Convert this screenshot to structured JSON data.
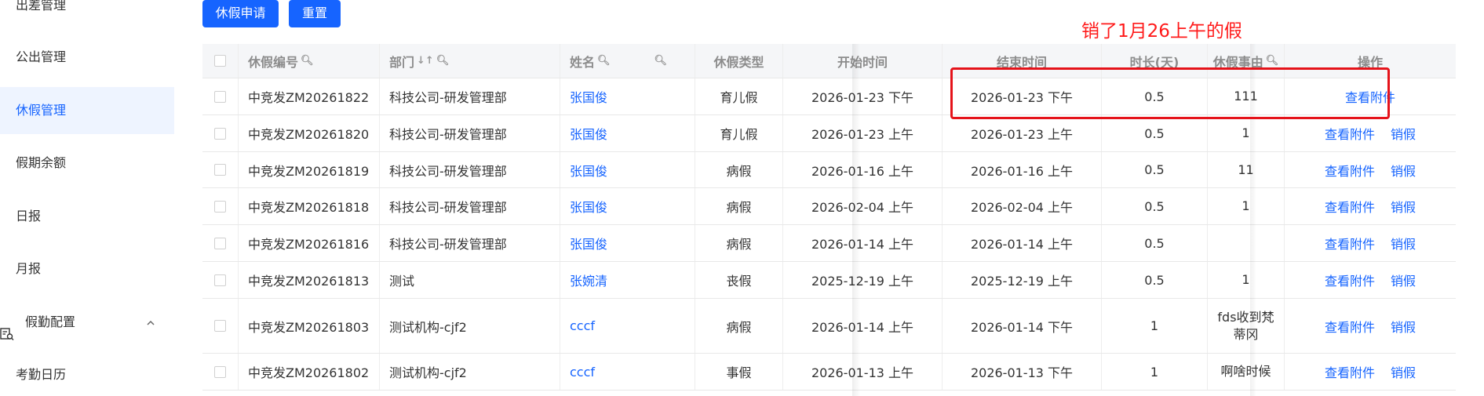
{
  "sidebar": {
    "items": [
      {
        "label": "出差管理",
        "active": false
      },
      {
        "label": "公出管理",
        "active": false
      },
      {
        "label": "休假管理",
        "active": true
      },
      {
        "label": "假期余额",
        "active": false
      },
      {
        "label": "日报",
        "active": false
      },
      {
        "label": "月报",
        "active": false
      }
    ],
    "group": {
      "label": "假勤配置",
      "icon": "list-search-icon",
      "chevron": "chevron-up-icon"
    },
    "sub_items": [
      {
        "label": "考勤日历"
      }
    ]
  },
  "toolbar": {
    "leave_apply_label": "休假申请",
    "reset_label": "重置"
  },
  "annotation": {
    "text": "销了1月26上午的假",
    "color": "#e5131a"
  },
  "table": {
    "headers": {
      "id": "休假编号",
      "dept": "部门",
      "sort_marks": "↓↑",
      "name": "姓名",
      "type": "休假类型",
      "start": "开始时间",
      "end": "结束时间",
      "duration": "时长(天)",
      "reason": "休假事由",
      "ops": "操作"
    },
    "rows": [
      {
        "id": "中竞发ZM20261822",
        "dept": "科技公司-研发管理部",
        "name": "张国俊",
        "type": "育儿假",
        "start": "2026-01-23 下午",
        "end": "2026-01-23 下午",
        "duration": "0.5",
        "reason": "111",
        "ops": [
          "查看附件"
        ]
      },
      {
        "id": "中竞发ZM20261820",
        "dept": "科技公司-研发管理部",
        "name": "张国俊",
        "type": "育儿假",
        "start": "2026-01-23 上午",
        "end": "2026-01-23 上午",
        "duration": "0.5",
        "reason": "1",
        "ops": [
          "查看附件",
          "销假"
        ]
      },
      {
        "id": "中竞发ZM20261819",
        "dept": "科技公司-研发管理部",
        "name": "张国俊",
        "type": "病假",
        "start": "2026-01-16 上午",
        "end": "2026-01-16 上午",
        "duration": "0.5",
        "reason": "11",
        "ops": [
          "查看附件",
          "销假"
        ]
      },
      {
        "id": "中竞发ZM20261818",
        "dept": "科技公司-研发管理部",
        "name": "张国俊",
        "type": "病假",
        "start": "2026-02-04 上午",
        "end": "2026-02-04 上午",
        "duration": "0.5",
        "reason": "1",
        "ops": [
          "查看附件",
          "销假"
        ]
      },
      {
        "id": "中竞发ZM20261816",
        "dept": "科技公司-研发管理部",
        "name": "张国俊",
        "type": "病假",
        "start": "2026-01-14 上午",
        "end": "2026-01-14 上午",
        "duration": "0.5",
        "reason": "",
        "ops": [
          "查看附件",
          "销假"
        ]
      },
      {
        "id": "中竞发ZM20261813",
        "dept": "测试",
        "name": "张婉清",
        "type": "丧假",
        "start": "2025-12-19 上午",
        "end": "2025-12-19 上午",
        "duration": "0.5",
        "reason": "1",
        "ops": [
          "查看附件",
          "销假"
        ]
      },
      {
        "id": "中竞发ZM20261803",
        "dept": "测试机构-cjf2",
        "name": "cccf",
        "type": "病假",
        "start": "2026-01-14 上午",
        "end": "2026-01-14 下午",
        "duration": "1",
        "reason": "fds收到梵蒂冈",
        "ops": [
          "查看附件",
          "销假"
        ]
      },
      {
        "id": "中竞发ZM20261802",
        "dept": "测试机构-cjf2",
        "name": "cccf",
        "type": "事假",
        "start": "2026-01-13 上午",
        "end": "2026-01-13 下午",
        "duration": "1",
        "reason": "啊啥时候",
        "ops": [
          "查看附件",
          "销假"
        ]
      }
    ]
  },
  "colors": {
    "primary": "#1664ff",
    "active_bg": "#eef4ff",
    "annotation": "#e5131a"
  }
}
